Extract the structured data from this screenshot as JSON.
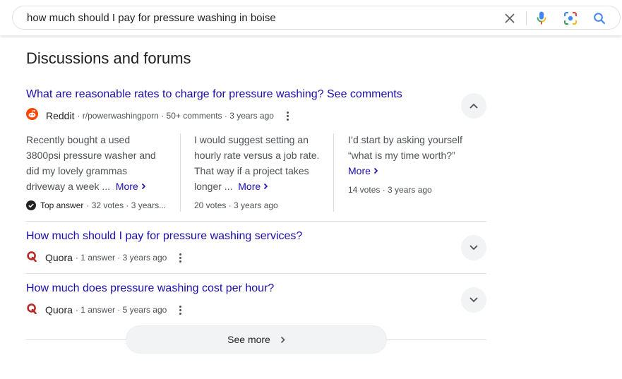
{
  "search": {
    "query": "how much should I pay for pressure washing in boise"
  },
  "section": {
    "title": "Discussions and forums"
  },
  "threads": [
    {
      "title": "What are reasonable rates to charge for pressure washing? See comments",
      "source": "Reddit",
      "meta": "· r/powerwashingporn · 50+ comments · 3 years ago",
      "expanded": true,
      "answers": [
        {
          "text": "Recently bought a used 3800psi pressure washer and did my lovely grammas driveway a week ...",
          "more": "More",
          "badge": "Top answer",
          "meta": "· 32 votes · 3 years..."
        },
        {
          "text": "I would suggest setting an hourly rate versus a job rate. That way if a project takes longer ...",
          "more": "More",
          "meta": "20 votes · 3 years ago"
        },
        {
          "text": "I’d start by asking yourself “what is my time worth?”",
          "more": "More",
          "meta": "14 votes · 3 years ago"
        }
      ]
    },
    {
      "title": "How much should I pay for pressure washing services?",
      "source": "Quora",
      "meta": "· 1 answer · 3 years ago",
      "expanded": false
    },
    {
      "title": "How much does pressure washing cost per hour?",
      "source": "Quora",
      "meta": "· 1 answer · 5 years ago",
      "expanded": false
    }
  ],
  "see_more": {
    "label": "See more"
  },
  "colors": {
    "link": "#1a0dab",
    "reddit": "#ff4500",
    "quora": "#b92b27",
    "muted": "#4d5156"
  },
  "icons": [
    "clear-icon",
    "microphone-icon",
    "lens-icon",
    "search-icon",
    "reddit-icon",
    "quora-icon",
    "kebab-menu-icon",
    "chevron-up-icon",
    "chevron-down-icon",
    "chevron-right-icon",
    "check-circle-icon"
  ]
}
